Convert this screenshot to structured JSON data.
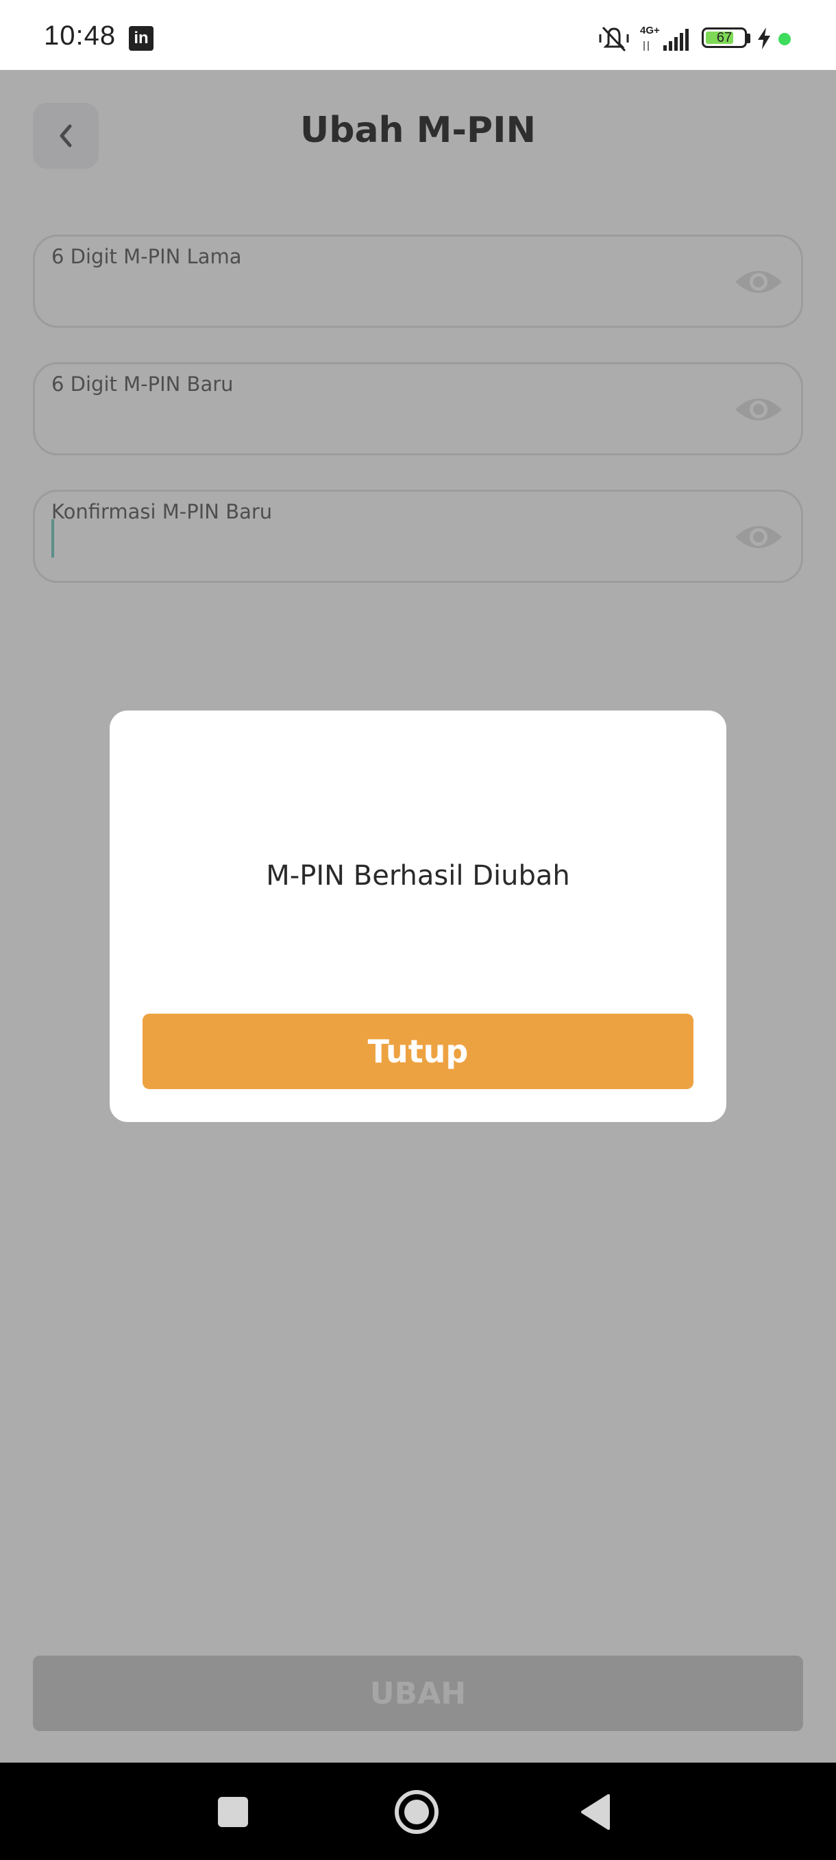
{
  "status_bar": {
    "time": "10:48",
    "app_icon": "linkedin-icon",
    "network_label": "4G+",
    "battery_level": 67,
    "battery_text": "67",
    "charging": true,
    "icons": [
      "mute-vibrate-icon",
      "signal-icon",
      "battery-icon",
      "charging-bolt-icon",
      "status-dot-icon"
    ]
  },
  "header": {
    "back_icon": "chevron-left-icon",
    "title": "Ubah M-PIN"
  },
  "form": {
    "fields": [
      {
        "label": "6 Digit M-PIN Lama",
        "value": "",
        "icon": "eye-icon"
      },
      {
        "label": "6 Digit M-PIN Baru",
        "value": "",
        "icon": "eye-icon"
      },
      {
        "label": "Konfirmasi M-PIN Baru",
        "value": "",
        "icon": "eye-icon"
      }
    ],
    "submit_label": "UBAH"
  },
  "dialog": {
    "message": "M-PIN Berhasil Diubah",
    "close_label": "Tutup"
  },
  "colors": {
    "overlay": "#acacac",
    "accent": "#eda241",
    "dialog_bg": "#ffffff",
    "battery_fill": "#7ed957"
  },
  "navigation": {
    "icons": [
      "recents-square-icon",
      "home-circle-icon",
      "back-triangle-icon"
    ]
  }
}
